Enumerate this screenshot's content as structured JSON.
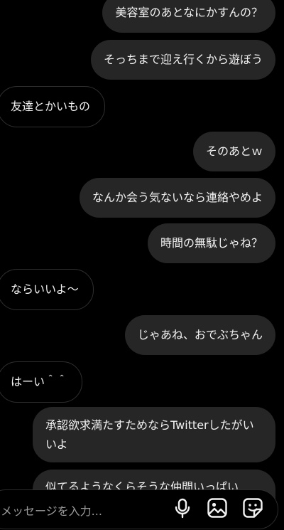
{
  "messages": [
    {
      "side": "out",
      "text": "美容室のあとなにかすんの？"
    },
    {
      "side": "out",
      "text": "そっちまで迎え行くから遊ぼう"
    },
    {
      "side": "in",
      "text": "友達とかいもの"
    },
    {
      "side": "out",
      "text": "そのあとｗ"
    },
    {
      "side": "out",
      "text": "なんか会う気ないなら連絡やめよ"
    },
    {
      "side": "out",
      "text": "時間の無駄じゃね？"
    },
    {
      "side": "in",
      "text": "ならいいよ〜"
    },
    {
      "side": "out",
      "text": "じゃあね、おでぶちゃん"
    },
    {
      "side": "in",
      "text": "はーい＾＾"
    },
    {
      "side": "out",
      "text": "承認欲求満たすためならTwitterしたがいいよ"
    },
    {
      "side": "out",
      "text": "似てるようなくらそうな仲間いっぱい"
    }
  ],
  "composer": {
    "placeholder": "メッセージを入力..."
  },
  "icons": {
    "mic": "microphone-icon",
    "gallery": "image-gallery-icon",
    "sticker": "sticker-icon"
  },
  "colors": {
    "background": "#000000",
    "outgoing_bubble": "#262626",
    "incoming_border": "#2f2f2f",
    "text": "#f2f2f2",
    "placeholder": "#9a9a9a"
  }
}
